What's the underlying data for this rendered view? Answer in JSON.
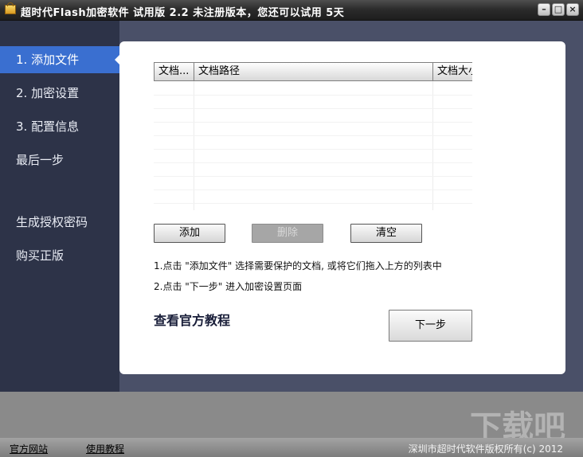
{
  "window": {
    "title": "超时代Flash加密软件 试用版 2.2  未注册版本，您还可以试用 5天",
    "controls": [
      "–",
      "□",
      "×"
    ]
  },
  "sidebar": {
    "items": [
      {
        "label": "1. 添加文件",
        "active": true
      },
      {
        "label": "2. 加密设置"
      },
      {
        "label": "3. 配置信息"
      },
      {
        "label": "最后一步"
      },
      {
        "label": "生成授权密码"
      },
      {
        "label": "购买正版"
      }
    ]
  },
  "file_table": {
    "columns": [
      "文档...",
      "文档路径",
      "文档大小"
    ],
    "rows": []
  },
  "buttons": {
    "add": "添加",
    "delete": "删除",
    "clear": "清空",
    "next": "下一步"
  },
  "hints": [
    "1.点击 \"添加文件\" 选择需要保护的文档, 或将它们拖入上方的列表中",
    "2.点击 \"下一步\" 进入加密设置页面"
  ],
  "tutorial_link": "查看官方教程",
  "footer": {
    "official_site": "官方网站",
    "tutorial": "使用教程",
    "copyright": "深圳市超时代软件版权所有(c) 2012"
  },
  "colors": {
    "sidebar_bg": "#2d3348",
    "active_item": "#3a6fd0",
    "panel_bg": "#ffffff"
  }
}
